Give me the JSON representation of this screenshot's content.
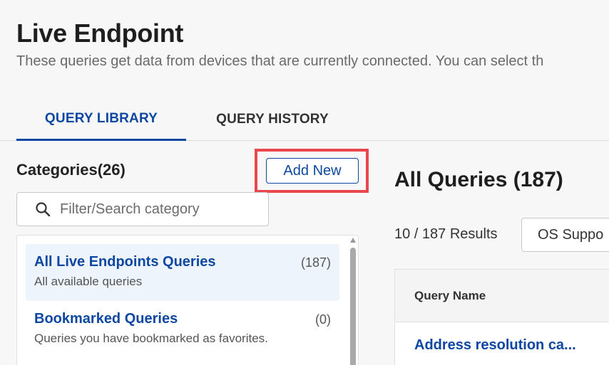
{
  "header": {
    "title": "Live Endpoint",
    "subtitle": "These queries get data from devices that are currently connected. You can select th"
  },
  "tabs": [
    {
      "label": "QUERY LIBRARY",
      "active": true
    },
    {
      "label": "QUERY HISTORY",
      "active": false
    }
  ],
  "categories": {
    "title": "Categories(26)",
    "add_new_label": "Add New",
    "filter_placeholder": "Filter/Search category",
    "items": [
      {
        "name": "All Live Endpoints Queries",
        "count": "(187)",
        "description": "All available queries",
        "selected": true
      },
      {
        "name": "Bookmarked Queries",
        "count": "(0)",
        "description": "Queries you have bookmarked as favorites.",
        "selected": false
      }
    ]
  },
  "queries": {
    "title": "All Queries (187)",
    "results": "10 / 187 Results",
    "os_filter_label": "OS Suppo",
    "table": {
      "column_header": "Query Name",
      "rows": [
        "Address resolution ca..."
      ]
    }
  },
  "colors": {
    "accent": "#0d47a1",
    "highlight": "#e8474c",
    "selected_bg": "#eef4fc"
  },
  "icons": {
    "search": "search-icon"
  }
}
